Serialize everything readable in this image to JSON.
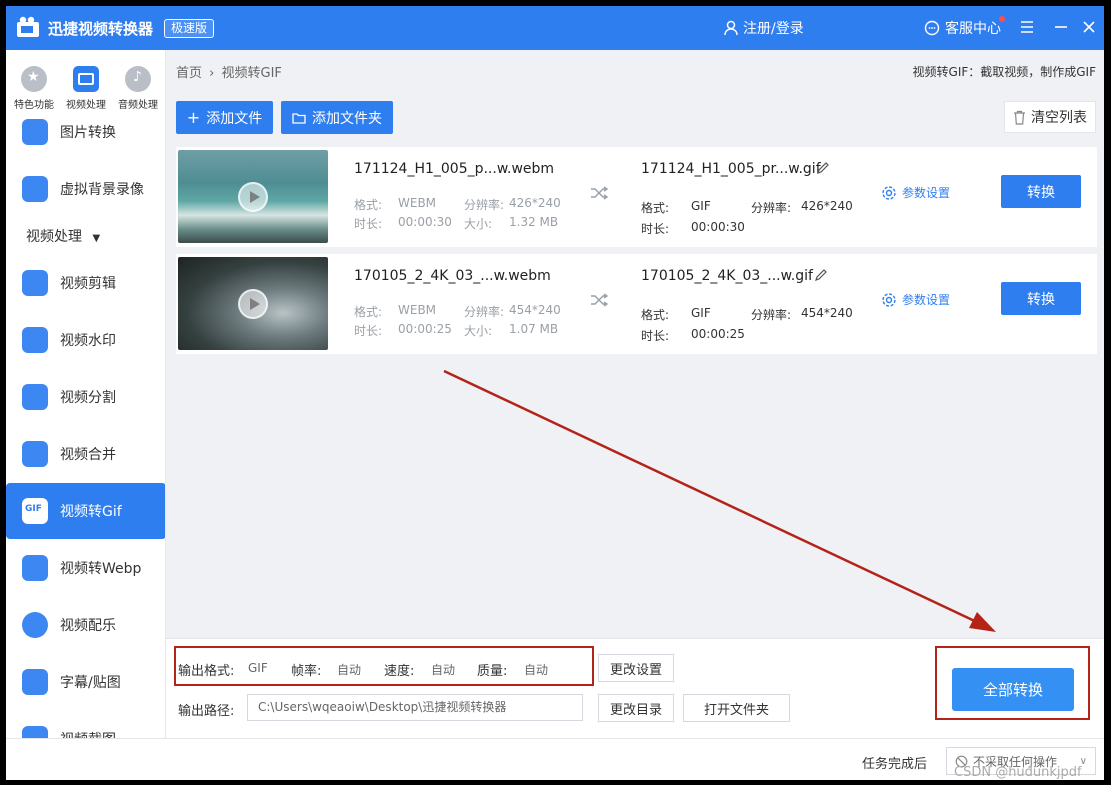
{
  "titlebar": {
    "app_title": "迅捷视频转换器",
    "edition": "极速版",
    "login": "注册/登录",
    "service": "客服中心"
  },
  "categories": [
    {
      "label": "特色功能",
      "icon": "star-icon"
    },
    {
      "label": "视频处理",
      "icon": "film-icon"
    },
    {
      "label": "音频处理",
      "icon": "music-icon"
    }
  ],
  "sidebar": {
    "items_top": [
      {
        "label": "图片转换",
        "icon": "image-icon"
      },
      {
        "label": "虚拟背景录像",
        "icon": "virtual-bg-icon"
      }
    ],
    "section": "视频处理",
    "items": [
      {
        "label": "视频剪辑",
        "icon": "cut-icon"
      },
      {
        "label": "视频水印",
        "icon": "watermark-icon"
      },
      {
        "label": "视频分割",
        "icon": "split-icon"
      },
      {
        "label": "视频合并",
        "icon": "merge-icon"
      },
      {
        "label": "视频转Gif",
        "icon": "gif-icon"
      },
      {
        "label": "视频转Webp",
        "icon": "webp-icon"
      },
      {
        "label": "视频配乐",
        "icon": "music-note-icon"
      },
      {
        "label": "字幕/贴图",
        "icon": "sticker-icon"
      },
      {
        "label": "视频截图",
        "icon": "screenshot-icon"
      }
    ]
  },
  "breadcrumb": {
    "home": "首页",
    "sep": "›",
    "current": "视频转GIF"
  },
  "page_desc": "视频转GIF：截取视频，制作成GIF",
  "toolbar": {
    "add_file": "添加文件",
    "add_folder": "添加文件夹",
    "clear": "清空列表"
  },
  "files": [
    {
      "src_name": "171124_H1_005_p...w.webm",
      "src_format_label": "格式:",
      "src_format": "WEBM",
      "src_res_label": "分辨率:",
      "src_res": "426*240",
      "src_dur_label": "时长:",
      "src_dur": "00:00:30",
      "src_size_label": "大小:",
      "src_size": "1.32 MB",
      "out_name": "171124_H1_005_pr...w.gif",
      "out_format_label": "格式:",
      "out_format": "GIF",
      "out_res_label": "分辨率:",
      "out_res": "426*240",
      "out_dur_label": "时长:",
      "out_dur": "00:00:30",
      "param": "参数设置",
      "convert": "转换"
    },
    {
      "src_name": "170105_2_4K_03_...w.webm",
      "src_format_label": "格式:",
      "src_format": "WEBM",
      "src_res_label": "分辨率:",
      "src_res": "454*240",
      "src_dur_label": "时长:",
      "src_dur": "00:00:25",
      "src_size_label": "大小:",
      "src_size": "1.07 MB",
      "out_name": "170105_2_4K_03_...w.gif",
      "out_format_label": "格式:",
      "out_format": "GIF",
      "out_res_label": "分辨率:",
      "out_res": "454*240",
      "out_dur_label": "时长:",
      "out_dur": "00:00:25",
      "param": "参数设置",
      "convert": "转换"
    }
  ],
  "settings": {
    "format_label": "输出格式:",
    "format": "GIF",
    "fps_label": "帧率:",
    "fps": "自动",
    "speed_label": "速度:",
    "speed": "自动",
    "quality_label": "质量:",
    "quality": "自动",
    "change_settings": "更改设置",
    "path_label": "输出路径:",
    "path": "C:\\Users\\wqeaoiw\\Desktop\\迅捷视频转换器",
    "change_dir": "更改目录",
    "open_folder": "打开文件夹",
    "convert_all": "全部转换"
  },
  "footer": {
    "after_label": "任务完成后",
    "after_value": "不采取任何操作",
    "watermark": "CSDN @hudunkjpdf"
  },
  "colors": {
    "accent": "#2f7ef0",
    "annotation": "#b42318"
  }
}
